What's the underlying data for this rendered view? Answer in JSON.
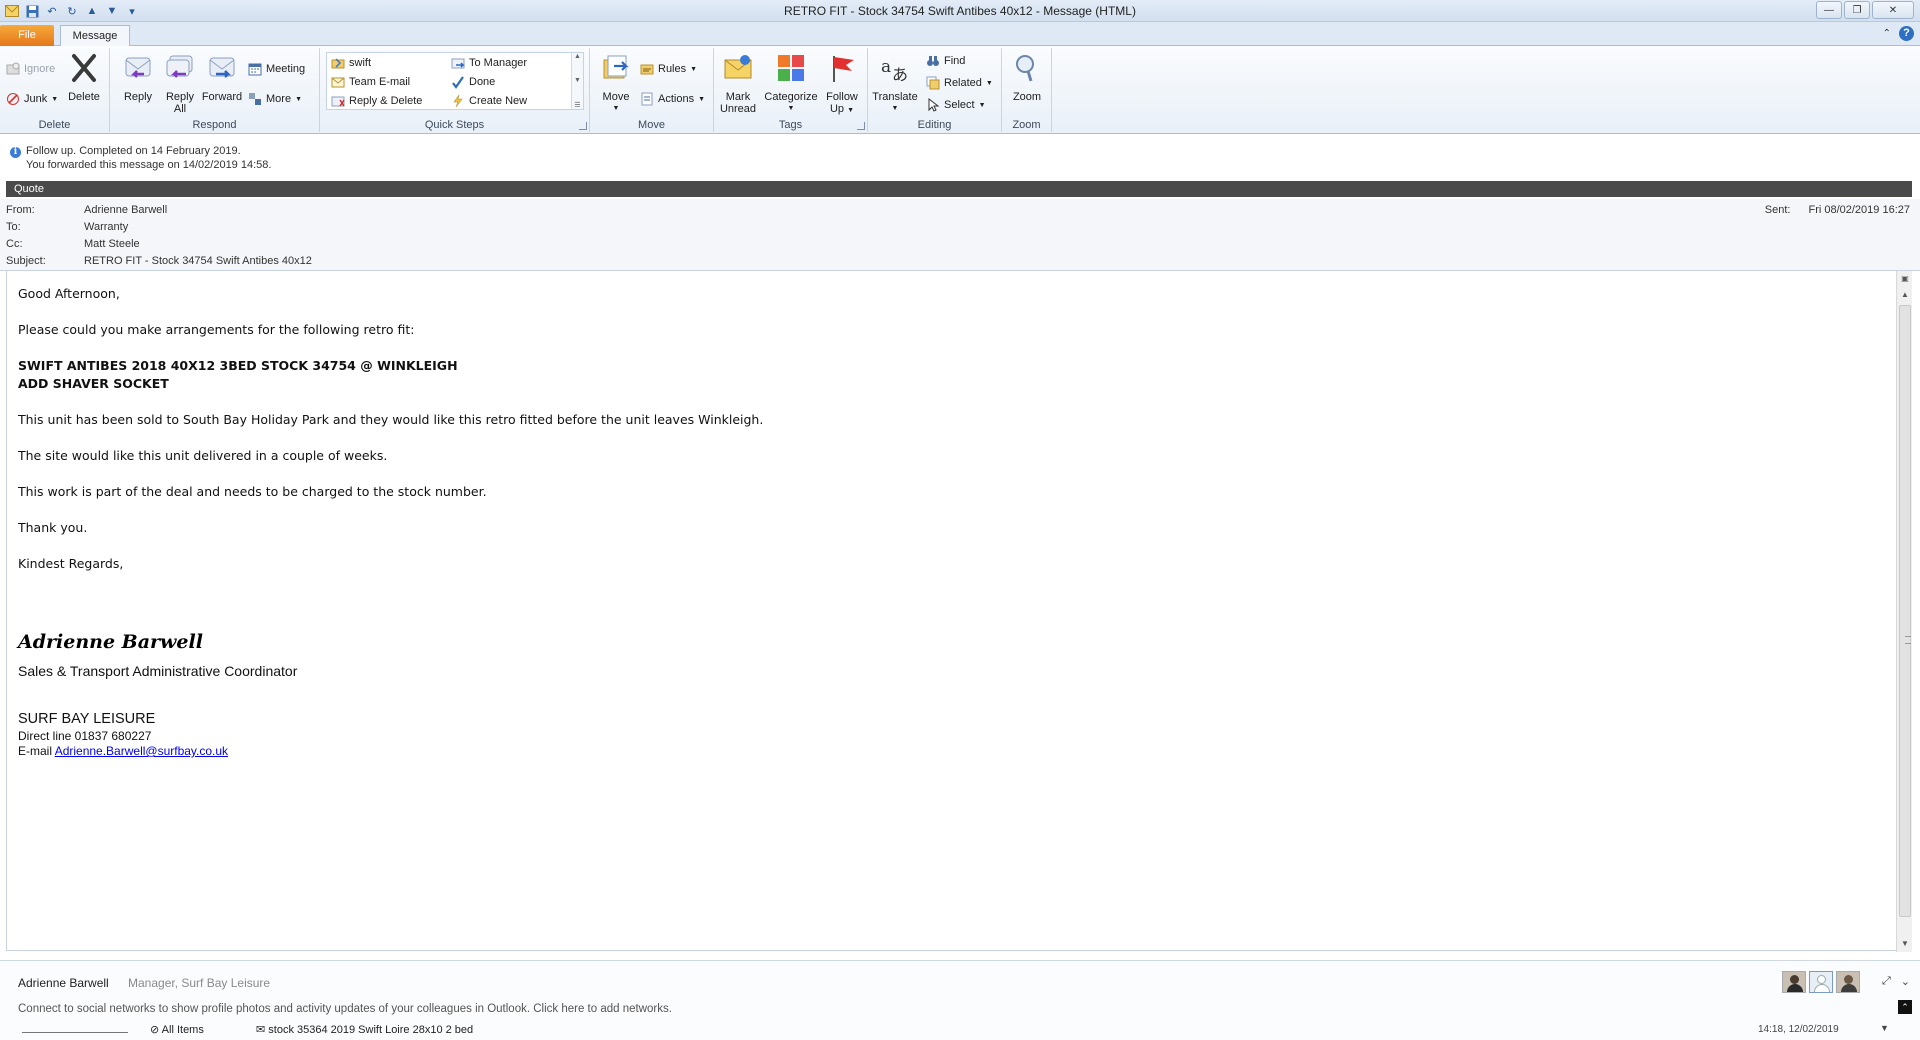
{
  "window": {
    "title": "RETRO FIT - Stock 34754 Swift Antibes 40x12  - Message (HTML)"
  },
  "tabs": {
    "file": "File",
    "message": "Message"
  },
  "ribbon": {
    "delete_group": {
      "label": "Delete",
      "ignore": "Ignore",
      "junk": "Junk",
      "delete": "Delete"
    },
    "respond_group": {
      "label": "Respond",
      "reply": "Reply",
      "reply_all_1": "Reply",
      "reply_all_2": "All",
      "forward": "Forward",
      "meeting": "Meeting",
      "more": "More"
    },
    "quick_steps_group": {
      "label": "Quick Steps",
      "items": [
        "swift",
        "Team E-mail",
        "Reply & Delete",
        "To Manager",
        "Done",
        "Create New"
      ]
    },
    "move_group": {
      "label": "Move",
      "move": "Move",
      "rules": "Rules",
      "actions": "Actions"
    },
    "tags_group": {
      "label": "Tags",
      "mark_unread_1": "Mark",
      "mark_unread_2": "Unread",
      "categorize": "Categorize",
      "follow_up_1": "Follow",
      "follow_up_2": "Up"
    },
    "editing_group": {
      "label": "Editing",
      "translate": "Translate",
      "find": "Find",
      "related": "Related",
      "select": "Select"
    },
    "zoom_group": {
      "label": "Zoom",
      "zoom": "Zoom"
    }
  },
  "info": {
    "line1": "Follow up.  Completed on 14 February 2019.",
    "line2": "You forwarded this message on 14/02/2019 14:58."
  },
  "header": {
    "category": "Quote",
    "from_label": "From:",
    "from": "Adrienne Barwell",
    "to_label": "To:",
    "to": "Warranty",
    "cc_label": "Cc:",
    "cc": "Matt Steele",
    "subject_label": "Subject:",
    "subject": "RETRO FIT - Stock 34754 Swift Antibes 40x12",
    "sent_label": "Sent:",
    "sent": "Fri 08/02/2019 16:27"
  },
  "message": {
    "greeting": "Good Afternoon,",
    "p1": "Please could you make arrangements for the following retro fit:",
    "bold1": "SWIFT ANTIBES 2018 40X12 3BED STOCK 34754 @ WINKLEIGH",
    "bold2": "ADD SHAVER SOCKET",
    "p2": "This unit has been sold to South Bay Holiday Park and they would like this retro fitted before the unit leaves Winkleigh.",
    "p3": "The site would like this unit delivered in a couple of weeks.",
    "p4": "This work is part of the deal and needs to be charged to the stock number.",
    "thanks": "Thank you.",
    "regards": "Kindest Regards,",
    "sig_name": "Adrienne Barwell",
    "sig_role": "Sales & Transport  Administrative Coordinator",
    "sig_company": "SURF BAY LEISURE",
    "sig_direct": "Direct line 01837 680227",
    "sig_email_label": "E-mail ",
    "sig_email": "Adrienne.Barwell@surfbay.co.uk"
  },
  "people_pane": {
    "name": "Adrienne Barwell",
    "title": "Manager, Surf Bay Leisure",
    "note": "Connect to social networks to show profile photos and activity updates of your colleagues in Outlook. Click here to add networks."
  },
  "status": {
    "folder": "All Items",
    "item": "stock 35364 2019 Swift Loire 28x10 2 bed",
    "time": "14:18, 12/02/2019"
  },
  "colors": {
    "file_tab": "#e4771b",
    "quote_category": "#4a4a4a",
    "link": "#0000ee",
    "ribbon_bg": "#e9f0f8"
  }
}
